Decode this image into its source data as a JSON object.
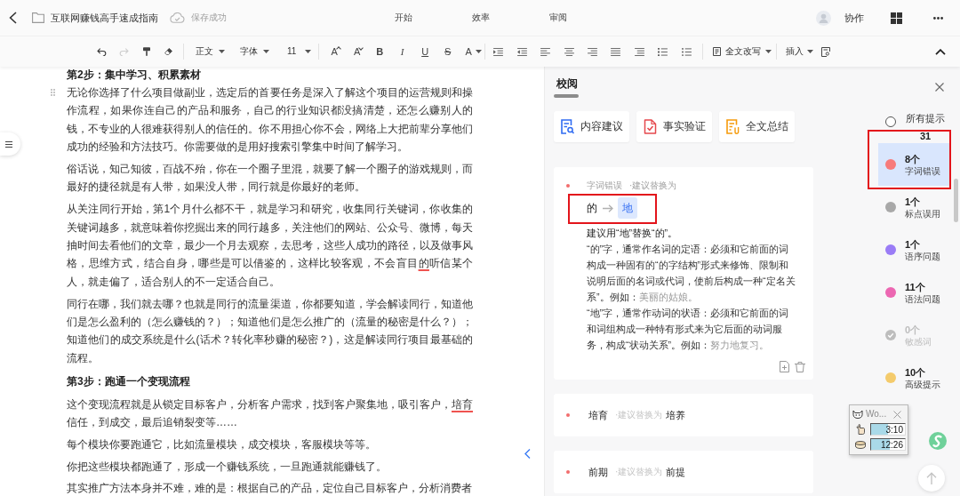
{
  "header": {
    "title": "互联网赚钱高手速成指南",
    "save_status": "保存成功",
    "tabs": [
      {
        "label": "开始",
        "selected": false
      },
      {
        "label": "效率",
        "selected": false
      },
      {
        "label": "审阅",
        "selected": false
      }
    ],
    "collaborate": "协作"
  },
  "toolbar": {
    "history": [
      {
        "kind": "undo",
        "disabled": false
      },
      {
        "kind": "redo",
        "disabled": true
      }
    ],
    "paragraph_style": "正文",
    "font_family": "字体",
    "font_size": "11",
    "format_buttons": [
      {
        "kind": "grow",
        "glyph": "A"
      },
      {
        "kind": "shrink",
        "glyph": "A"
      },
      {
        "kind": "bold",
        "glyph": "B"
      },
      {
        "kind": "italic",
        "glyph": "I"
      },
      {
        "kind": "underline",
        "glyph": "U"
      },
      {
        "kind": "strike",
        "glyph": "S"
      },
      {
        "kind": "color",
        "glyph": "A"
      }
    ],
    "rewrite": "全文改写",
    "insert": "插入"
  },
  "document": {
    "blocks": [
      {
        "kind": "heading",
        "runs": [
          {
            "text": "第2步：集中学习、积累素材",
            "flagged": false
          }
        ]
      },
      {
        "kind": "paragraph",
        "runs": [
          {
            "text": "无论你选择了什么项目做副业，选定后的首要任务是深入了解这个项目的运营规则和操作流程，如果你连自己的产品和服务，自己的行业知识都没搞清楚，还怎么赚别人的钱，不专业的人很难获得别人的信任的。你不用担心你不会，网络上大把前辈分享他们成功的经验和方法技巧。你需要做的是用好搜索引擎集中时间了解学习。",
            "flagged": false
          }
        ]
      },
      {
        "kind": "paragraph",
        "runs": [
          {
            "text": "俗话说，知己知彼，百战不殆，你在一个圈子里混，就要了解一个圈子的游戏规则，而最好的捷径就是有人带，如果没人带，同行就是你最好的老师。",
            "flagged": false
          }
        ]
      },
      {
        "kind": "paragraph",
        "runs": [
          {
            "text": "从关注同行开始，第1个月什么都不干，就是学习和研究，收集同行关键词，你收集的关键词越多，就意味着你挖掘出来的同行越多，关注他们的网站、公众号、微博，每天抽时间去看他们的文章，最少一个月去观察，去思考，这些人成功的路径，以及做事风格，思维方式，结合自身，哪些是可以借鉴的，这样比较客观，不会盲目",
            "flagged": false
          },
          {
            "text": "的",
            "flagged": true
          },
          {
            "text": "听信某个人，就走偏了，适合别人的不一定适合自己。",
            "flagged": false
          }
        ]
      },
      {
        "kind": "paragraph",
        "runs": [
          {
            "text": "同行在哪，我们就去哪？也就是同行的流量渠道，你都要知道，学会解读同行，知道他们是怎么盈利的（怎么赚钱的？）；知道他们是怎么推广的（流量的秘密是什么？）；知道他们的成交系统是什么(话术？转化率秒赚的秘密？)，这是解读同行项目最基础的流程。",
            "flagged": false
          }
        ]
      },
      {
        "kind": "heading",
        "runs": [
          {
            "text": "第3步：跑通一个变现流程",
            "flagged": false
          }
        ]
      },
      {
        "kind": "paragraph",
        "runs": [
          {
            "text": "这个变现流程就是从锁定目标客户，分析客户需求，找到客户聚集地，吸引客户，",
            "flagged": false
          },
          {
            "text": "培育",
            "flagged": true
          },
          {
            "text": "信任，到成交，最后追销裂变等……",
            "flagged": false
          }
        ]
      },
      {
        "kind": "paragraph",
        "runs": [
          {
            "text": "每个模块你要跑通它，比如流量模块，成交模块，客服模块等等。",
            "flagged": false
          }
        ]
      },
      {
        "kind": "paragraph",
        "runs": [
          {
            "text": "你把这些模块都跑通了，形成一个赚钱系统，一旦跑通就能赚钱了。",
            "flagged": false
          }
        ]
      },
      {
        "kind": "paragraph",
        "runs": [
          {
            "text": "其实推广方法本身并不难，难的是：根据自己的产品，定位自己目标客户，分析消费者",
            "flagged": false
          }
        ]
      }
    ]
  },
  "review_panel": {
    "title": "校阅",
    "actions": [
      "内容建议",
      "事实验证",
      "全文总结"
    ],
    "suggestions": [
      {
        "expanded": true,
        "framed": true,
        "category": "字词错误",
        "hint": "·建议替换为",
        "original": "的",
        "replacement": "地",
        "summary": "建议用“地”替换“的”。",
        "details": [
          {
            "runs": [
              {
                "text": "“的”字，通常作名词的定语：必须和它前面的词构成一种固有的“的字结构”形式来修饰、限制和说明后面的名词或代词，使前后构成一种“定名关系”。例如：",
                "example": false
              },
              {
                "text": "美丽的姑娘。",
                "example": true
              }
            ]
          },
          {
            "runs": [
              {
                "text": "“地”字，通常作动词的状语：必须和它前面的词和词组构成一种特有形式来为它后面的动词服务，构成“状动关系”。例如：",
                "example": false
              },
              {
                "text": "努力地复习。",
                "example": true
              }
            ]
          }
        ]
      },
      {
        "expanded": false,
        "framed": false,
        "original": "培育",
        "hint": "·建议替换为",
        "replacement": "培养"
      },
      {
        "expanded": false,
        "framed": false,
        "original": "前期",
        "hint": "·建议替换为",
        "replacement": "前提"
      }
    ],
    "categories": [
      {
        "kind": "all",
        "label": "所有提示",
        "count": "31",
        "selected": false,
        "disabled": false,
        "framed": false
      },
      {
        "kind": "dot",
        "label": "字词错误",
        "count": "8个",
        "color": "#f77b7b",
        "selected": true,
        "disabled": false,
        "framed": true
      },
      {
        "kind": "dot",
        "label": "标点误用",
        "count": "1个",
        "color": "#a8a8a8",
        "selected": false,
        "disabled": false,
        "framed": false
      },
      {
        "kind": "dot",
        "label": "语序问题",
        "count": "1个",
        "color": "#9a7cf6",
        "selected": false,
        "disabled": false,
        "framed": false
      },
      {
        "kind": "dot",
        "label": "语法问题",
        "count": "11个",
        "color": "#ec67b2",
        "selected": false,
        "disabled": false,
        "framed": false
      },
      {
        "kind": "check",
        "label": "敏感词",
        "count": "0个",
        "selected": false,
        "disabled": true,
        "framed": false
      },
      {
        "kind": "dot",
        "label": "高级提示",
        "count": "10个",
        "color": "#f4cb6c",
        "selected": false,
        "disabled": false,
        "framed": false
      }
    ]
  },
  "timer_widget": {
    "title": "Wo...",
    "rows": [
      {
        "time": "3:10",
        "level": 0.5
      },
      {
        "time": "12:26",
        "level": 0.55
      }
    ]
  }
}
